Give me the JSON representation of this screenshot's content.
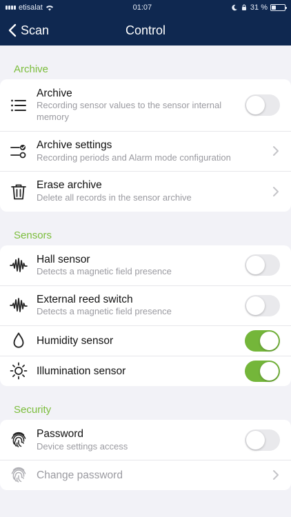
{
  "status_bar": {
    "carrier": "etisalat",
    "time": "01:07",
    "battery": "31 %",
    "battery_level": 0.31
  },
  "nav": {
    "back_label": "Scan",
    "title": "Control"
  },
  "colors": {
    "nav_background": "#0f2850",
    "section_header": "#7bbd3b",
    "toggle_on": "#74b63a",
    "toggle_off": "#e9e9ec"
  },
  "sections": {
    "archive": {
      "header": "Archive",
      "items": [
        {
          "title": "Archive",
          "subtitle": "Recording sensor values to the sensor internal memory",
          "icon": "list-icon",
          "control": "toggle",
          "on": false
        },
        {
          "title": "Archive settings",
          "subtitle": "Recording periods and Alarm mode configuration",
          "icon": "settings-sliders-icon",
          "control": "chevron"
        },
        {
          "title": "Erase archive",
          "subtitle": "Delete all records in the sensor archive",
          "icon": "trash-icon",
          "control": "chevron"
        }
      ]
    },
    "sensors": {
      "header": "Sensors",
      "items": [
        {
          "title": "Hall sensor",
          "subtitle": "Detects a magnetic field presence",
          "icon": "waveform-icon",
          "control": "toggle",
          "on": false
        },
        {
          "title": "External reed switch",
          "subtitle": "Detects a magnetic field presence",
          "icon": "waveform-icon",
          "control": "toggle",
          "on": false
        },
        {
          "title": "Humidity sensor",
          "icon": "droplet-icon",
          "control": "toggle",
          "on": true
        },
        {
          "title": "Illumination sensor",
          "icon": "sun-icon",
          "control": "toggle",
          "on": true
        }
      ]
    },
    "security": {
      "header": "Security",
      "items": [
        {
          "title": "Password",
          "subtitle": "Device settings access",
          "icon": "fingerprint-icon",
          "control": "toggle",
          "on": false
        },
        {
          "title": "Change password",
          "icon": "fingerprint-icon",
          "control": "chevron",
          "disabled": true
        }
      ]
    }
  }
}
